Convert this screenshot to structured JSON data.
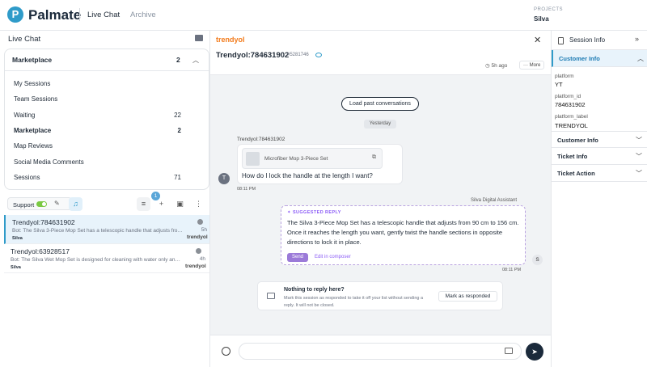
{
  "header": {
    "logo_letter": "P",
    "brand": "Palmate",
    "nav": [
      "Live Chat",
      "Archive"
    ],
    "projects_label": "PROJECTS",
    "project_name": "Silva"
  },
  "sidebar": {
    "title": "Live Chat",
    "group": {
      "title": "Marketplace",
      "count": "2"
    },
    "items": [
      {
        "label": "My Sessions",
        "count": ""
      },
      {
        "label": "Team Sessions",
        "count": ""
      },
      {
        "label": "Waiting",
        "count": "22"
      },
      {
        "label": "Marketplace",
        "count": "2"
      },
      {
        "label": "Map Reviews",
        "count": ""
      },
      {
        "label": "Social Media Comments",
        "count": ""
      },
      {
        "label": "Sessions",
        "count": "71"
      }
    ],
    "support_label": "Support",
    "filter_badge": "1",
    "sessions": [
      {
        "name": "Trendyol:784631902",
        "preview": "Bot: The Silva 3-Piece Mop Set has a telescopic handle that adjusts from 90 cm to 156 cm",
        "agent": "Silva",
        "time": "5h",
        "source": "trendyol"
      },
      {
        "name": "Trendyol:63928517",
        "preview": "Bot: The Silva Wet Mop Set is designed for cleaning with water only and is not suitable",
        "agent": "Silva",
        "time": "4h",
        "source": "trendyol"
      }
    ]
  },
  "conversation": {
    "channel_logo": "trendyol",
    "title": "Trendyol:784631902",
    "session_id": "#5281746",
    "time_ago": "5h ago",
    "more_label": "More",
    "load_past_label": "Load past conversations",
    "day_divider": "Yesterday",
    "customer_name": "Trendyol:784631902",
    "customer_initial": "T",
    "product_title": "Microfiber Mop 3-Piece Set",
    "customer_message": "How do I lock the handle at the length I want?",
    "customer_time": "08:11 PM",
    "assistant_name": "Silva Digital Assistant",
    "suggested_label": "SUGGESTED REPLY",
    "suggested_text": "The Silva 3-Piece Mop Set has a telescopic handle that adjusts from 90 cm to 156 cm. Once it reaches the length you want, gently twist the handle sections in opposite directions to lock it in place.",
    "send_label": "Send",
    "edit_label": "Edit in composer",
    "assistant_initial": "S",
    "assistant_time": "08:11 PM",
    "nothing_title": "Nothing to reply here?",
    "nothing_desc": "Mark this session as responded to take it off your list without sending a reply. It will not be closed.",
    "mark_label": "Mark as responded"
  },
  "session_info": {
    "title": "Session Info",
    "sections": [
      "Customer Info",
      "Customer Info",
      "Ticket Info",
      "Ticket Action"
    ],
    "fields": [
      {
        "key": "platform",
        "value": "YT"
      },
      {
        "key": "platform_id",
        "value": "784631902"
      },
      {
        "key": "platform_label",
        "value": "TRENDYOL"
      }
    ]
  },
  "colors": {
    "accent": "#2f9bc9",
    "suggest": "#8b5cf6",
    "trendyol": "#f27a1a",
    "toggle_on": "#7ac943"
  }
}
